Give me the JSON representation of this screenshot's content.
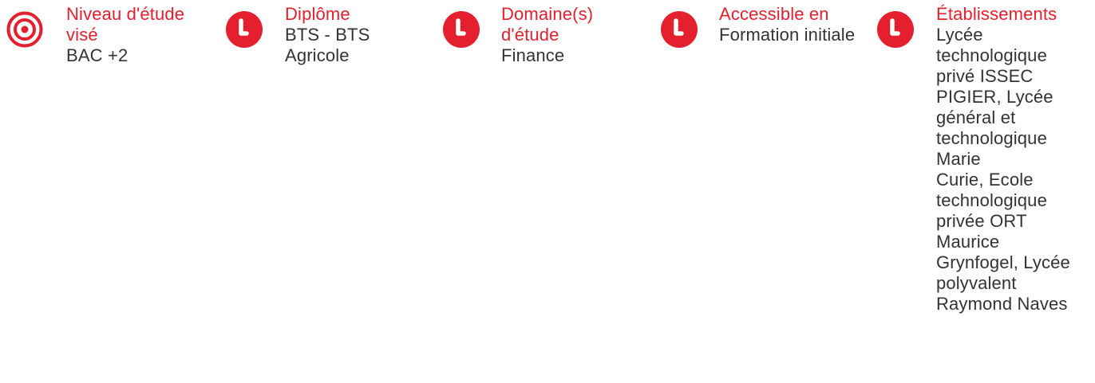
{
  "colors": {
    "accent": "#e4202e",
    "text": "#333333"
  },
  "items": [
    {
      "icon": "target-icon",
      "label": "Niveau d'étude visé",
      "value": "BAC +2"
    },
    {
      "icon": "clock-icon",
      "label": "Diplôme",
      "value": "BTS - BTS Agricole"
    },
    {
      "icon": "clock-icon",
      "label": "Domaine(s) d'étude",
      "value": "Finance"
    },
    {
      "icon": "clock-icon",
      "label": "Accessible en",
      "value": "Formation initiale"
    },
    {
      "icon": "clock-icon",
      "label": "Établissements",
      "value": "Lycée\ntechnologique\nprivé ISSEC\nPIGIER, Lycée\ngénéral et\ntechnologique\nMarie\nCurie, Ecole\ntechnologique\nprivée ORT\nMaurice\nGrynfogel, Lycée\npolyvalent\nRaymond Naves"
    }
  ]
}
